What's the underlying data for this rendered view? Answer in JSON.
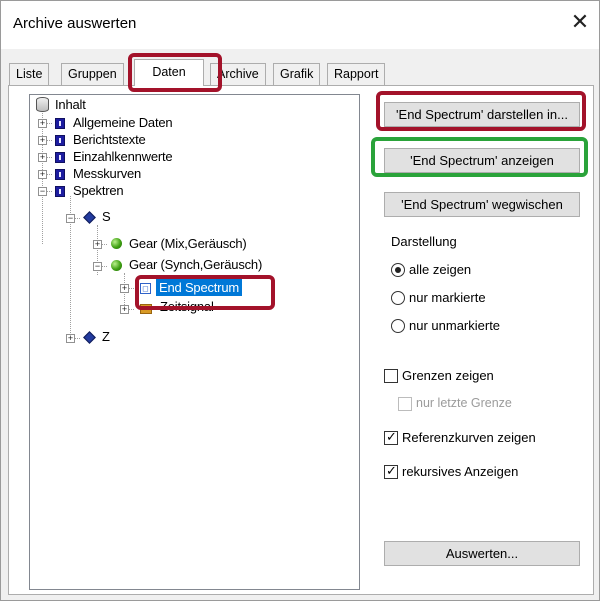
{
  "window": {
    "title": "Archive auswerten",
    "close_glyph": "✕"
  },
  "tabs": [
    {
      "label": "Liste",
      "active": false
    },
    {
      "label": "Gruppen",
      "active": false
    },
    {
      "label": "Daten",
      "active": true
    },
    {
      "label": "Archive",
      "active": false
    },
    {
      "label": "Grafik",
      "active": false
    },
    {
      "label": "Rapport",
      "active": false
    }
  ],
  "tree": {
    "root": {
      "label": "Inhalt",
      "icon": "database-icon"
    },
    "level1": [
      {
        "label": "Allgemeine Daten",
        "icon": "book-icon",
        "expanded": false
      },
      {
        "label": "Berichtstexte",
        "icon": "book-icon",
        "expanded": false
      },
      {
        "label": "Einzahlkennwerte",
        "icon": "book-icon",
        "expanded": false
      },
      {
        "label": "Messkurven",
        "icon": "book-icon",
        "expanded": false
      },
      {
        "label": "Spektren",
        "icon": "book-icon",
        "expanded": true
      }
    ],
    "spektren_children": [
      {
        "label": "S",
        "icon": "diamond-icon",
        "expanded": true
      },
      {
        "label": "Z",
        "icon": "diamond-icon",
        "expanded": false
      }
    ],
    "s_children": [
      {
        "label": "Gear (Mix,Geräusch)",
        "icon": "green-ball-icon",
        "expanded": false
      },
      {
        "label": "Gear (Synch,Geräusch)",
        "icon": "green-ball-icon",
        "expanded": true
      }
    ],
    "gear_synch_children": [
      {
        "label": "End Spectrum",
        "icon": "spectrum-icon",
        "selected": true
      },
      {
        "label": "Zeitsignal",
        "icon": "signal-icon",
        "selected": false
      }
    ]
  },
  "actions": {
    "darstellen_label": "'End Spectrum' darstellen in...",
    "anzeigen_label": "'End Spectrum' anzeigen",
    "wegwischen_label": "'End Spectrum' wegwischen",
    "auswerten_label": "Auswerten..."
  },
  "darstellung": {
    "label": "Darstellung",
    "options": [
      {
        "label": "alle zeigen",
        "checked": true
      },
      {
        "label": "nur markierte",
        "checked": false
      },
      {
        "label": "nur unmarkierte",
        "checked": false
      }
    ]
  },
  "checkboxes": {
    "grenzen_zeigen": {
      "label": "Grenzen zeigen",
      "checked": false,
      "enabled": true
    },
    "nur_letzte_grenze": {
      "label": "nur letzte Grenze",
      "checked": false,
      "enabled": false
    },
    "referenzkurven_zeigen": {
      "label": "Referenzkurven zeigen",
      "checked": true,
      "enabled": true
    },
    "rekursives_anzeigen": {
      "label": "rekursives Anzeigen",
      "checked": true,
      "enabled": true
    }
  },
  "colors": {
    "highlight_red": "#a3122a",
    "highlight_green": "#2aa33a",
    "selection": "#0078d7"
  }
}
